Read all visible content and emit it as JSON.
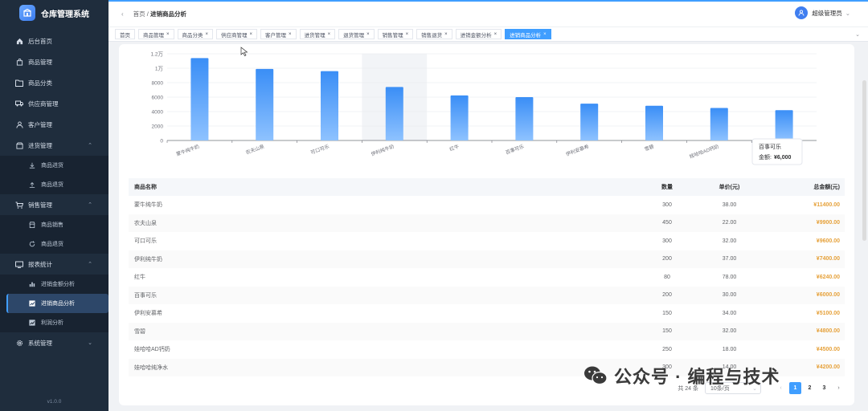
{
  "app": {
    "title": "仓库管理系统",
    "version": "v1.0.0"
  },
  "sidebar": {
    "items": [
      {
        "label": "后台首页",
        "icon": "home-icon"
      },
      {
        "label": "商品管理",
        "icon": "bag-icon"
      },
      {
        "label": "商品分类",
        "icon": "folder-icon"
      },
      {
        "label": "供应商管理",
        "icon": "truck-icon"
      },
      {
        "label": "客户管理",
        "icon": "user-icon"
      },
      {
        "label": "进货管理",
        "icon": "box-icon",
        "children": [
          {
            "label": "商品进货",
            "icon": "download-icon"
          },
          {
            "label": "商品退货",
            "icon": "upload-icon"
          }
        ]
      },
      {
        "label": "销售管理",
        "icon": "cart-icon",
        "children": [
          {
            "label": "商品销售",
            "icon": "shop-icon"
          },
          {
            "label": "商品退货",
            "icon": "refresh-icon"
          }
        ]
      },
      {
        "label": "报表统计",
        "icon": "report-icon",
        "children": [
          {
            "label": "进销金额分析",
            "icon": "bar-chart-icon"
          },
          {
            "label": "进销商品分析",
            "icon": "trend-icon"
          },
          {
            "label": "利润分析",
            "icon": "profit-icon"
          }
        ]
      },
      {
        "label": "系统管理",
        "icon": "gear-icon"
      }
    ]
  },
  "header": {
    "breadcrumb_home": "首页",
    "breadcrumb_sep": "/",
    "breadcrumb_current": "进销商品分析",
    "user_name": "超级管理员",
    "dropdown": "⌄"
  },
  "tabs": [
    {
      "label": "首页",
      "closable": false
    },
    {
      "label": "商品管理",
      "closable": true
    },
    {
      "label": "商品分类",
      "closable": true
    },
    {
      "label": "供应商管理",
      "closable": true
    },
    {
      "label": "客户管理",
      "closable": true
    },
    {
      "label": "进货管理",
      "closable": true
    },
    {
      "label": "退货管理",
      "closable": true
    },
    {
      "label": "销售管理",
      "closable": true
    },
    {
      "label": "销售退货",
      "closable": true
    },
    {
      "label": "进销金额分析",
      "closable": true
    },
    {
      "label": "进销商品分析",
      "closable": true,
      "active": true
    }
  ],
  "chart_data": {
    "type": "bar",
    "categories": [
      "蒙牛纯牛奶",
      "农夫山泉",
      "可口可乐",
      "伊利纯牛奶",
      "红牛",
      "百事可乐",
      "伊利安慕希",
      "雪碧",
      "娃哈哈AD钙奶",
      "娃哈哈纯净水"
    ],
    "values": [
      11400,
      9900,
      9600,
      7400,
      6240,
      6000,
      5100,
      4800,
      4500,
      4200
    ],
    "yticks": [
      "0",
      "2000",
      "4000",
      "6000",
      "8000",
      "1万",
      "1.2万"
    ],
    "ylim": [
      0,
      12000
    ],
    "highlight_index": 3,
    "bar_color_top": "#3a8ef6",
    "bar_color_bottom": "#8ec2ff",
    "tooltip": {
      "title": "百事可乐",
      "label": "金额:",
      "value": "¥6,000"
    }
  },
  "table": {
    "headers": [
      "商品名称",
      "数量",
      "单价(元)",
      "总金额(元)"
    ],
    "rows": [
      [
        "蒙牛纯牛奶",
        "300",
        "38.00",
        "¥11400.00"
      ],
      [
        "农夫山泉",
        "450",
        "22.00",
        "¥9900.00"
      ],
      [
        "可口可乐",
        "300",
        "32.00",
        "¥9600.00"
      ],
      [
        "伊利纯牛奶",
        "200",
        "37.00",
        "¥7400.00"
      ],
      [
        "红牛",
        "80",
        "78.00",
        "¥6240.00"
      ],
      [
        "百事可乐",
        "200",
        "30.00",
        "¥6000.00"
      ],
      [
        "伊利安慕希",
        "150",
        "34.00",
        "¥5100.00"
      ],
      [
        "雪碧",
        "150",
        "32.00",
        "¥4800.00"
      ],
      [
        "娃哈哈AD钙奶",
        "250",
        "18.00",
        "¥4500.00"
      ],
      [
        "娃哈哈纯净水",
        "300",
        "14.00",
        "¥4200.00"
      ]
    ]
  },
  "pager": {
    "total": "共 24 条",
    "page_size": "10条/页",
    "prev": "‹",
    "next": "›",
    "pages": [
      "1",
      "2",
      "3"
    ],
    "current": "1"
  },
  "watermark": "公众号 · 编程与技术"
}
